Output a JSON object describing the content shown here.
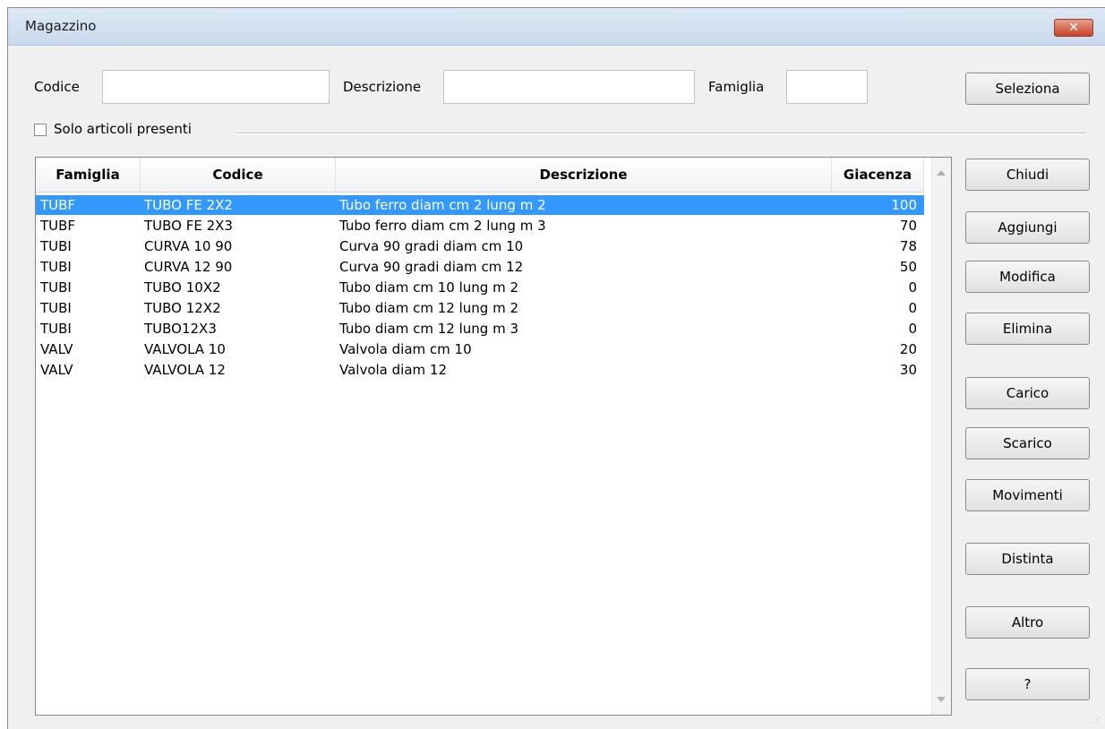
{
  "window": {
    "title": "Magazzino",
    "close_glyph": "✕"
  },
  "filters": {
    "codice_label": "Codice",
    "codice_value": "",
    "descrizione_label": "Descrizione",
    "descrizione_value": "",
    "famiglia_label": "Famiglia",
    "famiglia_value": "",
    "only_present_label": "Solo articoli presenti",
    "only_present_checked": false
  },
  "buttons": {
    "seleziona": "Seleziona",
    "chiudi": "Chiudi",
    "aggiungi": "Aggiungi",
    "modifica": "Modifica",
    "elimina": "Elimina",
    "carico": "Carico",
    "scarico": "Scarico",
    "movimenti": "Movimenti",
    "distinta": "Distinta",
    "altro": "Altro",
    "help": "?"
  },
  "table": {
    "columns": [
      "Famiglia",
      "Codice",
      "Descrizione",
      "Giacenza"
    ],
    "rows": [
      [
        "TUBF",
        "TUBO FE 2X2",
        "Tubo ferro diam cm 2 lung m 2",
        "100"
      ],
      [
        "TUBF",
        "TUBO FE 2X3",
        "Tubo ferro diam cm 2 lung m 3",
        "70"
      ],
      [
        "TUBI",
        "CURVA 10 90",
        "Curva 90 gradi diam cm 10",
        "78"
      ],
      [
        "TUBI",
        "CURVA 12 90",
        "Curva 90 gradi diam cm 12",
        "50"
      ],
      [
        "TUBI",
        "TUBO 10X2",
        "Tubo diam cm 10 lung m 2",
        "0"
      ],
      [
        "TUBI",
        "TUBO 12X2",
        "Tubo diam cm 12 lung m 2",
        "0"
      ],
      [
        "TUBI",
        "TUBO12X3",
        "Tubo diam cm 12 lung m 3",
        "0"
      ],
      [
        "VALV",
        "VALVOLA 10",
        "Valvola diam cm 10",
        "20"
      ],
      [
        "VALV",
        "VALVOLA 12",
        "Valvola diam 12",
        "30"
      ]
    ],
    "selected_row": 0
  },
  "colors": {
    "selection": "#3399ff",
    "window_bg": "#f0f0f0",
    "close_button": "#c7442a"
  },
  "icons": {
    "close": "close-icon",
    "scroll_up": "chevron-up-icon",
    "scroll_down": "chevron-down-icon",
    "resize": "resize-grip-icon"
  }
}
